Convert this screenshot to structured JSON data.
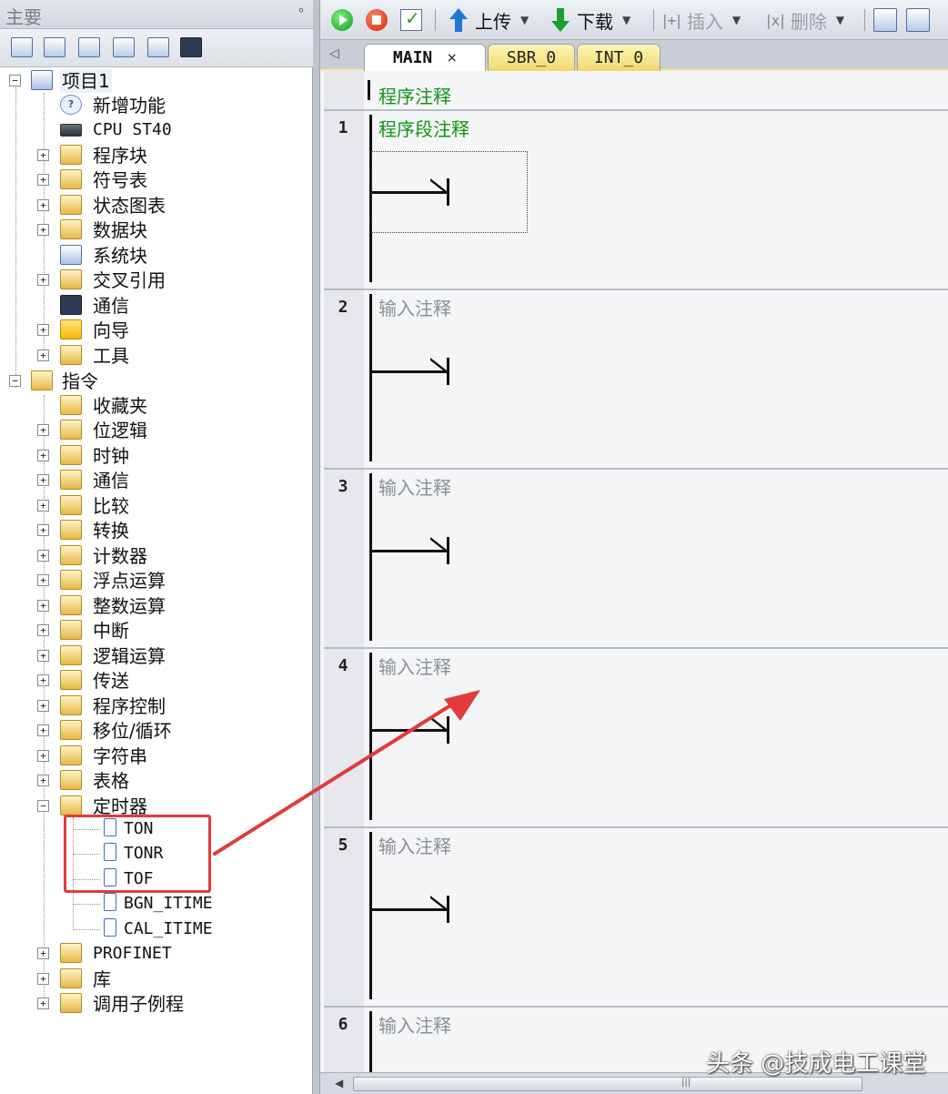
{
  "left_panel": {
    "title": "主要",
    "pin": "ᵒ"
  },
  "tree": {
    "project": "项目1",
    "project_items": [
      "新增功能",
      "CPU ST40",
      "程序块",
      "符号表",
      "状态图表",
      "数据块",
      "系统块",
      "交叉引用",
      "通信",
      "向导",
      "工具"
    ],
    "instructions": "指令",
    "instruction_items": [
      "收藏夹",
      "位逻辑",
      "时钟",
      "通信",
      "比较",
      "转换",
      "计数器",
      "浮点运算",
      "整数运算",
      "中断",
      "逻辑运算",
      "传送",
      "程序控制",
      "移位/循环",
      "字符串",
      "表格",
      "定时器"
    ],
    "timer_items": [
      "TON",
      "TONR",
      "TOF",
      "BGN_ITIME",
      "CAL_ITIME"
    ],
    "after_items": [
      "PROFINET",
      "库",
      "调用子例程"
    ],
    "expand_plus": "+",
    "expand_minus": "−"
  },
  "toolbar": {
    "upload": "上传",
    "download": "下载",
    "insert": "插入",
    "delete": "删除"
  },
  "tabs": {
    "main": "MAIN",
    "close": "×",
    "sbr": "SBR_0",
    "int": "INT_0",
    "scroll_left": "◁"
  },
  "editor": {
    "program_comment": "程序注释",
    "networks": [
      {
        "number": "1",
        "comment": "程序段注释"
      },
      {
        "number": "2",
        "comment": "输入注释"
      },
      {
        "number": "3",
        "comment": "输入注释"
      },
      {
        "number": "4",
        "comment": "输入注释"
      },
      {
        "number": "5",
        "comment": "输入注释"
      },
      {
        "number": "6",
        "comment": "输入注释"
      }
    ]
  },
  "scrollbar": {
    "left_arrow": "◀",
    "grip": "|||"
  },
  "watermark": "头条 @技成电工课堂",
  "colors": {
    "highlight_box": "#e23b3b",
    "comment_green": "#129312",
    "comment_gray": "#8a8f96"
  }
}
